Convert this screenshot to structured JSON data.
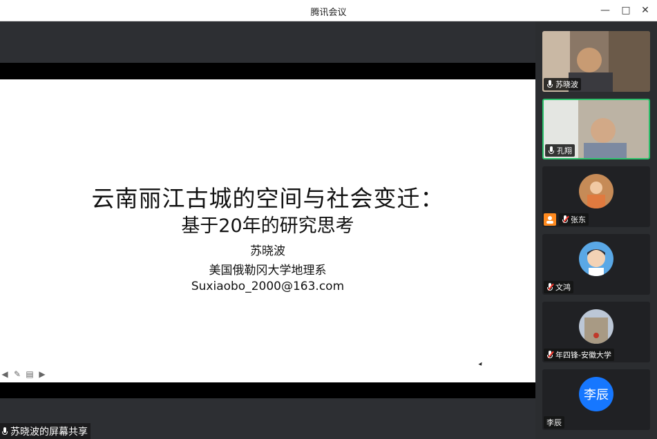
{
  "window": {
    "title": "腾讯会议",
    "controls": [
      "minimize-icon",
      "maximize-icon",
      "close-icon"
    ]
  },
  "slide": {
    "title_line1": "云南丽江古城的空间与社会变迁：",
    "title_line2": "基于20年的研究思考",
    "author": "苏晓波",
    "affiliation": "美国俄勒冈大学地理系",
    "email": "Suxiaobo_2000@163.com"
  },
  "share_label": "苏晓波的屏幕共享",
  "participants": [
    {
      "name": "苏晓波",
      "mic": "on",
      "type": "video"
    },
    {
      "name": "孔翔",
      "mic": "on",
      "type": "video",
      "active": true
    },
    {
      "name": "张东",
      "mic": "off",
      "type": "avatar"
    },
    {
      "name": "文鸿",
      "mic": "off",
      "type": "avatar"
    },
    {
      "name": "年四锋-安徽大学",
      "mic": "off",
      "type": "avatar"
    },
    {
      "name": "李辰",
      "mic": "none",
      "type": "text-avatar",
      "avatar_text": "李辰"
    }
  ],
  "colors": {
    "active_border": "#2bc26b",
    "avatar_blue": "#1677ff",
    "muted_red": "#ff3b30",
    "host_badge": "#ff8a1f"
  }
}
